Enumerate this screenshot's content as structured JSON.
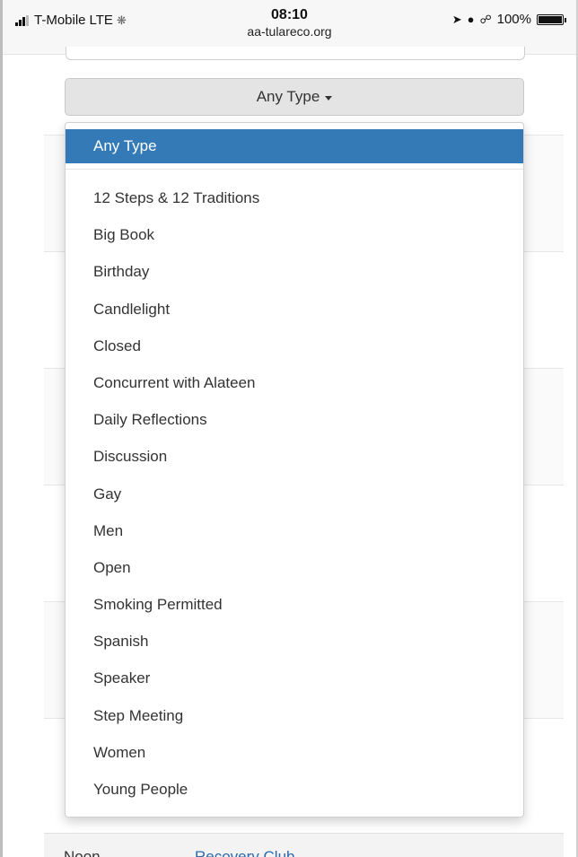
{
  "status_bar": {
    "carrier": "T-Mobile",
    "network": "LTE",
    "time": "08:10",
    "url": "aa-tulareco.org",
    "battery": "100%",
    "icons": [
      "signal-icon",
      "loading-icon",
      "location-icon",
      "alarm-icon",
      "headphones-icon",
      "battery-icon"
    ]
  },
  "filter": {
    "toggle_label": "Any Type",
    "selected": "Any Type",
    "options": [
      "12 Steps & 12 Traditions",
      "Big Book",
      "Birthday",
      "Candlelight",
      "Closed",
      "Concurrent with Alateen",
      "Daily Reflections",
      "Discussion",
      "Gay",
      "Men",
      "Open",
      "Smoking Permitted",
      "Spanish",
      "Speaker",
      "Step Meeting",
      "Women",
      "Young People"
    ]
  },
  "background_row": {
    "time": "Noon",
    "location": "Recovery Club"
  },
  "colors": {
    "active_bg": "#337ab7",
    "link": "#2a6aad"
  }
}
